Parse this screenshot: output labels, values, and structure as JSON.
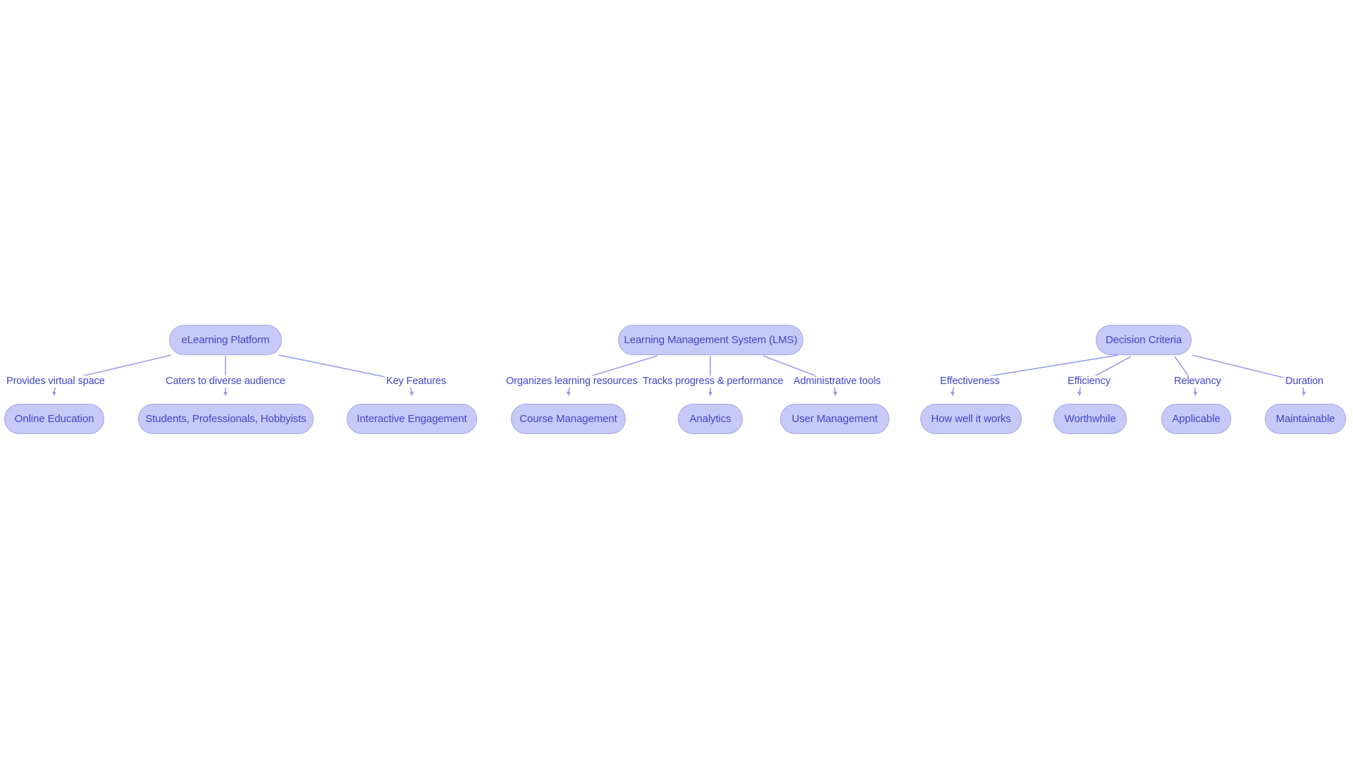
{
  "diagram": {
    "type": "flowchart",
    "background_color": "#ffffff",
    "node_fill_color": "#c7c9f7",
    "node_border_color": "#a3a6ee",
    "text_color": "#4045c8",
    "edge_color": "#9a9ee8",
    "clusters": [
      {
        "id": "cluster-elearning",
        "root": {
          "id": "elearning-platform",
          "label": "eLearning Platform"
        },
        "children": [
          {
            "id": "online-education",
            "label": "Online Education",
            "edge_label": "Provides virtual space"
          },
          {
            "id": "students-professionals-hobbyists",
            "label": "Students, Professionals, Hobbyists",
            "edge_label": "Caters to diverse audience"
          },
          {
            "id": "interactive-engagement",
            "label": "Interactive Engagement",
            "edge_label": "Key Features"
          }
        ]
      },
      {
        "id": "cluster-lms",
        "root": {
          "id": "learning-management-system",
          "label": "Learning Management System (LMS)"
        },
        "children": [
          {
            "id": "course-management",
            "label": "Course Management",
            "edge_label": "Organizes learning resources"
          },
          {
            "id": "analytics",
            "label": "Analytics",
            "edge_label": "Tracks progress & performance"
          },
          {
            "id": "user-management",
            "label": "User Management",
            "edge_label": "Administrative tools"
          }
        ]
      },
      {
        "id": "cluster-decision-criteria",
        "root": {
          "id": "decision-criteria",
          "label": "Decision Criteria"
        },
        "children": [
          {
            "id": "how-well-it-works",
            "label": "How well it works",
            "edge_label": "Effectiveness"
          },
          {
            "id": "worthwhile",
            "label": "Worthwhile",
            "edge_label": "Efficiency"
          },
          {
            "id": "applicable",
            "label": "Applicable",
            "edge_label": "Relevancy"
          },
          {
            "id": "maintainable",
            "label": "Maintainable",
            "edge_label": "Duration"
          }
        ]
      }
    ]
  }
}
